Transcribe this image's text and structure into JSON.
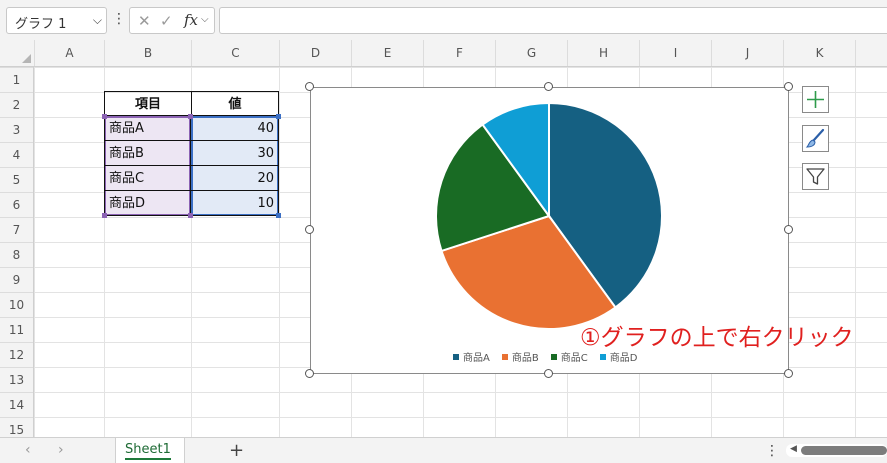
{
  "formula_bar": {
    "name_box": "グラフ 1",
    "cancel_icon": "✕",
    "enter_icon": "✓",
    "fx_label": "fx",
    "formula": ""
  },
  "columns": [
    "A",
    "B",
    "C",
    "D",
    "E",
    "F",
    "G",
    "H",
    "I",
    "J",
    "K"
  ],
  "rows": [
    "1",
    "2",
    "3",
    "4",
    "5",
    "6",
    "7",
    "8",
    "9",
    "10",
    "11",
    "12",
    "13",
    "14",
    "15"
  ],
  "table": {
    "headers": [
      "項目",
      "値"
    ],
    "rows": [
      [
        "商品A",
        "40"
      ],
      [
        "商品B",
        "30"
      ],
      [
        "商品C",
        "20"
      ],
      [
        "商品D",
        "10"
      ]
    ]
  },
  "chart_data": {
    "type": "pie",
    "categories": [
      "商品A",
      "商品B",
      "商品C",
      "商品D"
    ],
    "values": [
      40,
      30,
      20,
      10
    ],
    "colors": [
      "#156082",
      "#e97132",
      "#196b24",
      "#0f9ed5"
    ],
    "legend_position": "bottom",
    "title": ""
  },
  "chart_buttons": {
    "add_element_icon": "plus-icon",
    "style_icon": "brush-icon",
    "filter_icon": "funnel-icon"
  },
  "annotation": "①グラフの上で右クリック",
  "sheet_bar": {
    "sheet_name": "Sheet1",
    "add_label": "+"
  }
}
